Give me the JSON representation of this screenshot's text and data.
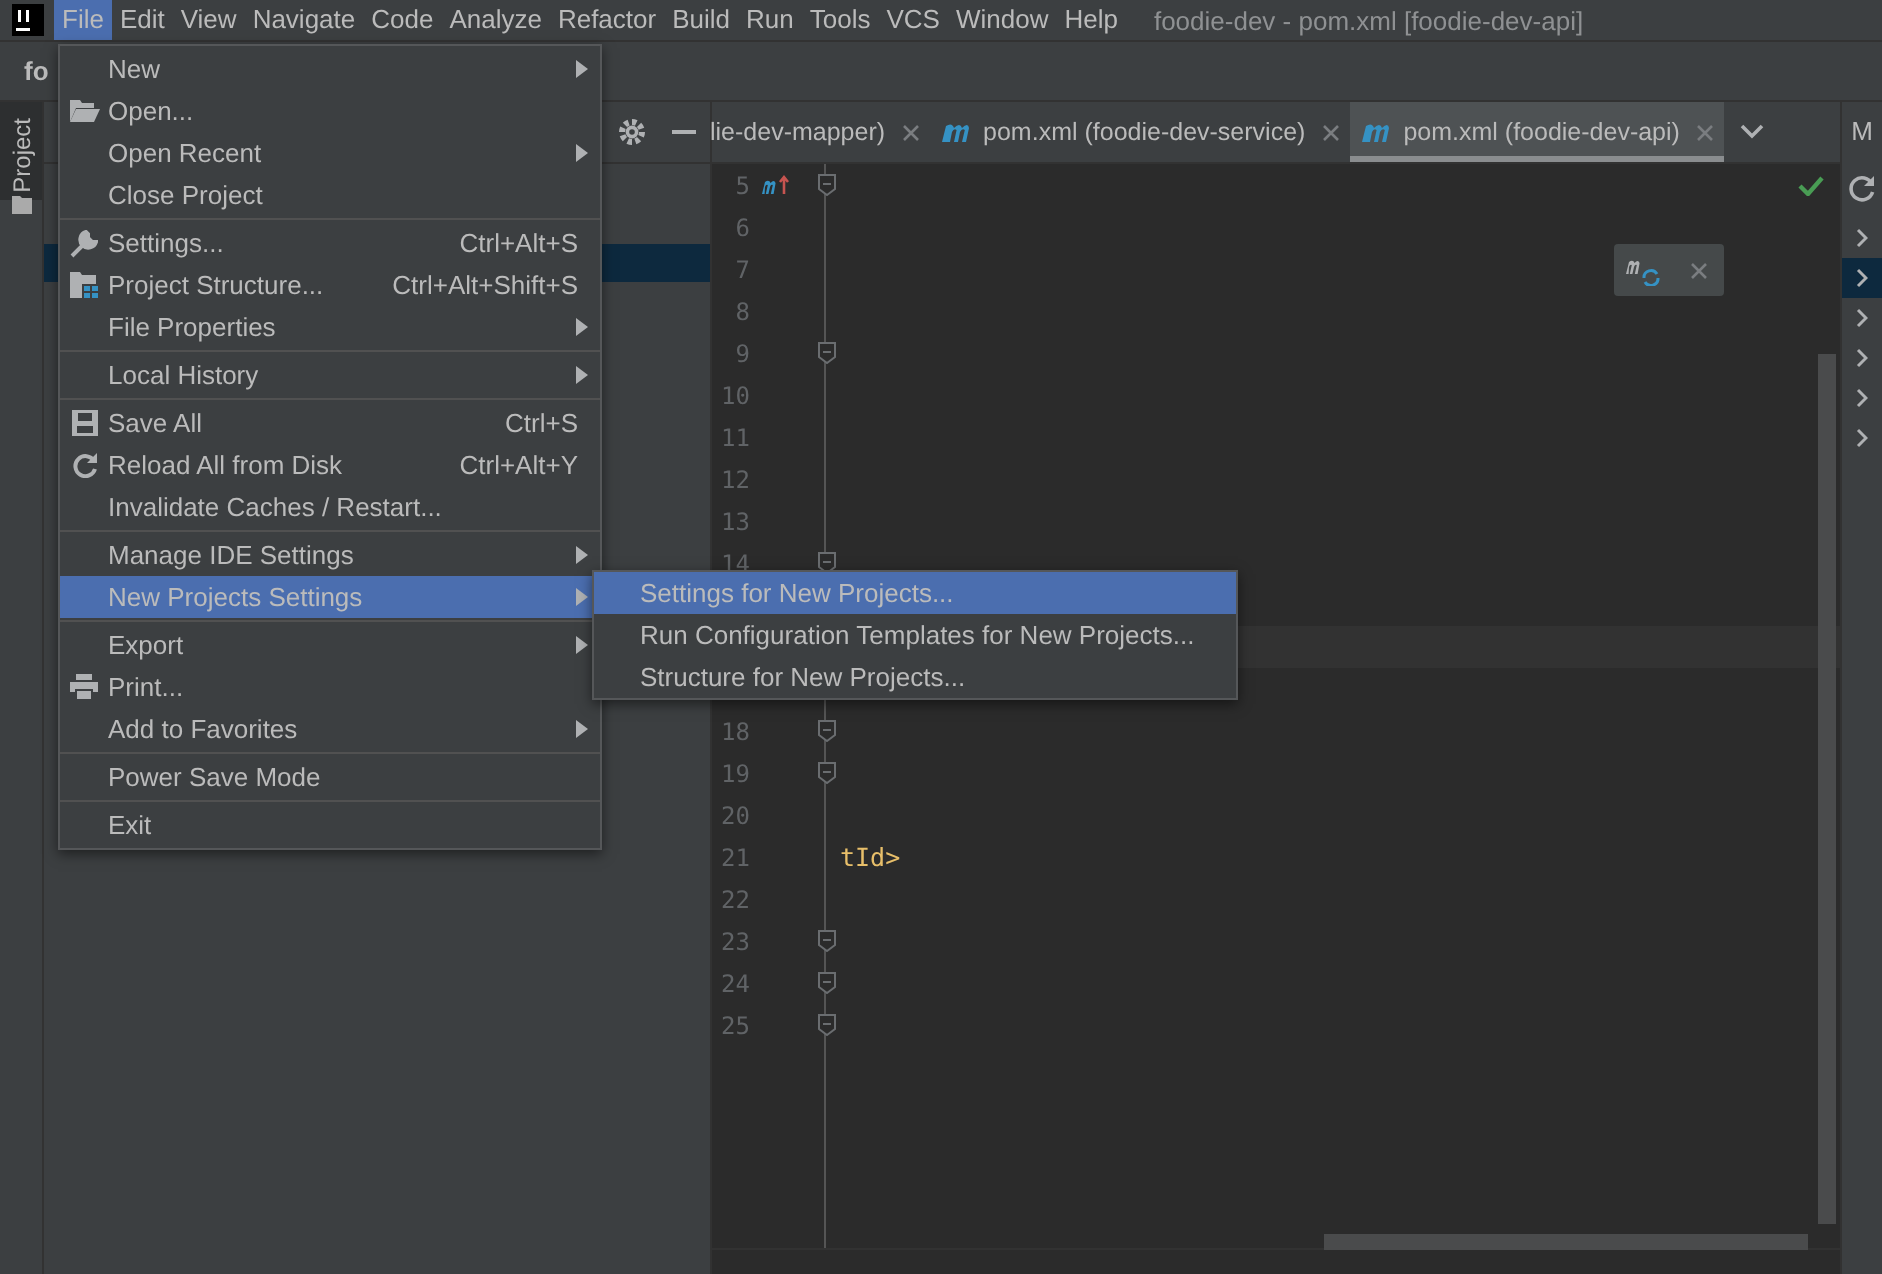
{
  "menubar": {
    "items": [
      {
        "label": "File",
        "selected": true
      },
      {
        "label": "Edit",
        "selected": false
      },
      {
        "label": "View",
        "selected": false
      },
      {
        "label": "Navigate",
        "selected": false
      },
      {
        "label": "Code",
        "selected": false
      },
      {
        "label": "Analyze",
        "selected": false
      },
      {
        "label": "Refactor",
        "selected": false
      },
      {
        "label": "Build",
        "selected": false
      },
      {
        "label": "Run",
        "selected": false
      },
      {
        "label": "Tools",
        "selected": false
      },
      {
        "label": "VCS",
        "selected": false
      },
      {
        "label": "Window",
        "selected": false
      },
      {
        "label": "Help",
        "selected": false
      }
    ],
    "title": "foodie-dev - pom.xml [foodie-dev-api]"
  },
  "navbar": {
    "project": "fo"
  },
  "left_stripe": {
    "tabs": [
      {
        "label": "Project",
        "selected": true
      }
    ]
  },
  "editor": {
    "tabs": [
      {
        "label": "lie-dev-mapper)",
        "selected": false
      },
      {
        "label": "pom.xml (foodie-dev-service)",
        "selected": false
      },
      {
        "label": "pom.xml (foodie-dev-api)",
        "selected": true
      }
    ],
    "lines_top": [
      {
        "number": "5",
        "fold": true
      },
      {
        "number": "6",
        "fold": false
      },
      {
        "number": "7",
        "fold": false
      },
      {
        "number": "8",
        "fold": false
      },
      {
        "number": "9",
        "fold": true
      },
      {
        "number": "10",
        "fold": false
      },
      {
        "number": "11",
        "fold": false
      },
      {
        "number": "12",
        "fold": false
      },
      {
        "number": "13",
        "fold": false
      },
      {
        "number": "14",
        "fold": true
      }
    ],
    "lines_bottom": [
      {
        "number": "18",
        "fold": true
      },
      {
        "number": "19",
        "fold": true
      },
      {
        "number": "20",
        "fold": false
      },
      {
        "number": "21",
        "fold": false,
        "code": "tId>"
      },
      {
        "number": "22",
        "fold": false
      },
      {
        "number": "23",
        "fold": true
      },
      {
        "number": "24",
        "fold": true
      },
      {
        "number": "25",
        "fold": true
      }
    ]
  },
  "right_stripe": {
    "title": "M"
  },
  "file_menu": {
    "groups": [
      [
        {
          "label": "New",
          "submenu": true,
          "selected": false
        },
        {
          "label": "Open...",
          "submenu": false,
          "selected": false
        },
        {
          "label": "Open Recent",
          "submenu": true,
          "selected": false
        },
        {
          "label": "Close Project",
          "submenu": false,
          "selected": false
        }
      ],
      [
        {
          "label": "Settings...",
          "shortcut": "Ctrl+Alt+S",
          "submenu": false,
          "selected": false
        },
        {
          "label": "Project Structure...",
          "shortcut": "Ctrl+Alt+Shift+S",
          "submenu": false,
          "selected": false
        },
        {
          "label": "File Properties",
          "submenu": true,
          "selected": false
        }
      ],
      [
        {
          "label": "Local History",
          "submenu": true,
          "selected": false
        }
      ],
      [
        {
          "label": "Save All",
          "shortcut": "Ctrl+S",
          "submenu": false,
          "selected": false
        },
        {
          "label": "Reload All from Disk",
          "shortcut": "Ctrl+Alt+Y",
          "submenu": false,
          "selected": false
        },
        {
          "label": "Invalidate Caches / Restart...",
          "submenu": false,
          "selected": false
        }
      ],
      [
        {
          "label": "Manage IDE Settings",
          "submenu": true,
          "selected": false
        },
        {
          "label": "New Projects Settings",
          "submenu": true,
          "selected": true
        }
      ],
      [
        {
          "label": "Export",
          "submenu": true,
          "selected": false
        },
        {
          "label": "Print...",
          "submenu": false,
          "selected": false
        },
        {
          "label": "Add to Favorites",
          "submenu": true,
          "selected": false
        }
      ],
      [
        {
          "label": "Power Save Mode",
          "submenu": false,
          "selected": false
        }
      ],
      [
        {
          "label": "Exit",
          "submenu": false,
          "selected": false
        }
      ]
    ]
  },
  "submenu": {
    "items": [
      {
        "label": "Settings for New Projects...",
        "selected": true
      },
      {
        "label": "Run Configuration Templates for New Projects...",
        "selected": false
      },
      {
        "label": "Structure for New Projects...",
        "selected": false
      }
    ]
  }
}
